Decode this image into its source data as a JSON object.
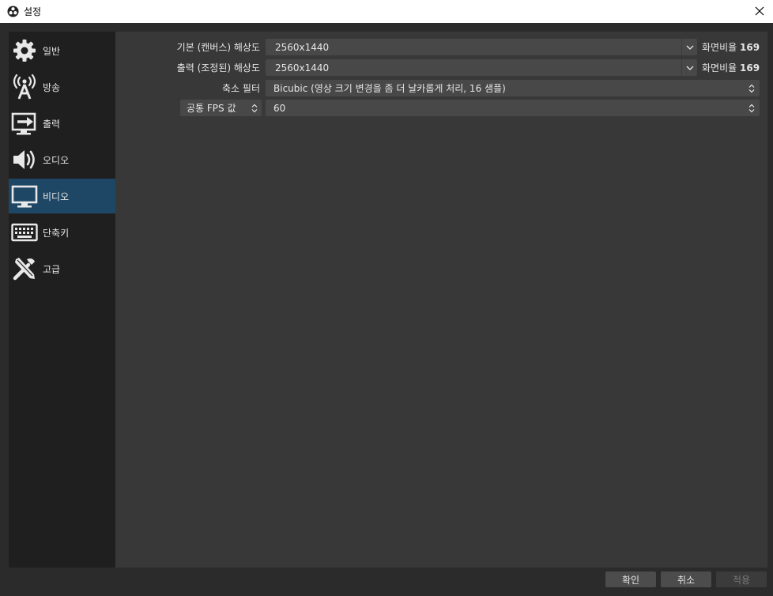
{
  "window": {
    "title": "설정",
    "icon": "obs-logo-icon",
    "close_icon": "close-icon"
  },
  "sidebar": {
    "items": [
      {
        "label": "일반",
        "icon": "gear-icon"
      },
      {
        "label": "방송",
        "icon": "broadcast-tower-icon"
      },
      {
        "label": "출력",
        "icon": "output-arrow-icon"
      },
      {
        "label": "오디오",
        "icon": "speaker-icon"
      },
      {
        "label": "비디오",
        "icon": "monitor-icon",
        "selected": true
      },
      {
        "label": "단축키",
        "icon": "keyboard-icon"
      },
      {
        "label": "고급",
        "icon": "tools-icon"
      }
    ]
  },
  "video": {
    "base_resolution": {
      "label": "기본 (캔버스) 해상도",
      "value": "2560x1440",
      "ratio_label": "화면비율",
      "ratio_value": "169"
    },
    "output_resolution": {
      "label": "출력 (조정된) 해상도",
      "value": "2560x1440",
      "ratio_label": "화면비율",
      "ratio_value": "169"
    },
    "downscale_filter": {
      "label": "축소 필터",
      "value": "Bicubic (영상 크기 변경을 좀 더 날카롭게 처리, 16 샘플)"
    },
    "fps": {
      "type_label": "공통 FPS 값",
      "value": "60"
    }
  },
  "buttons": {
    "ok": "확인",
    "cancel": "취소",
    "apply": "적용"
  },
  "colors": {
    "selected": "#1e4766",
    "panel": "#383838",
    "sidebar": "#1f1f1f",
    "field": "#484848"
  }
}
